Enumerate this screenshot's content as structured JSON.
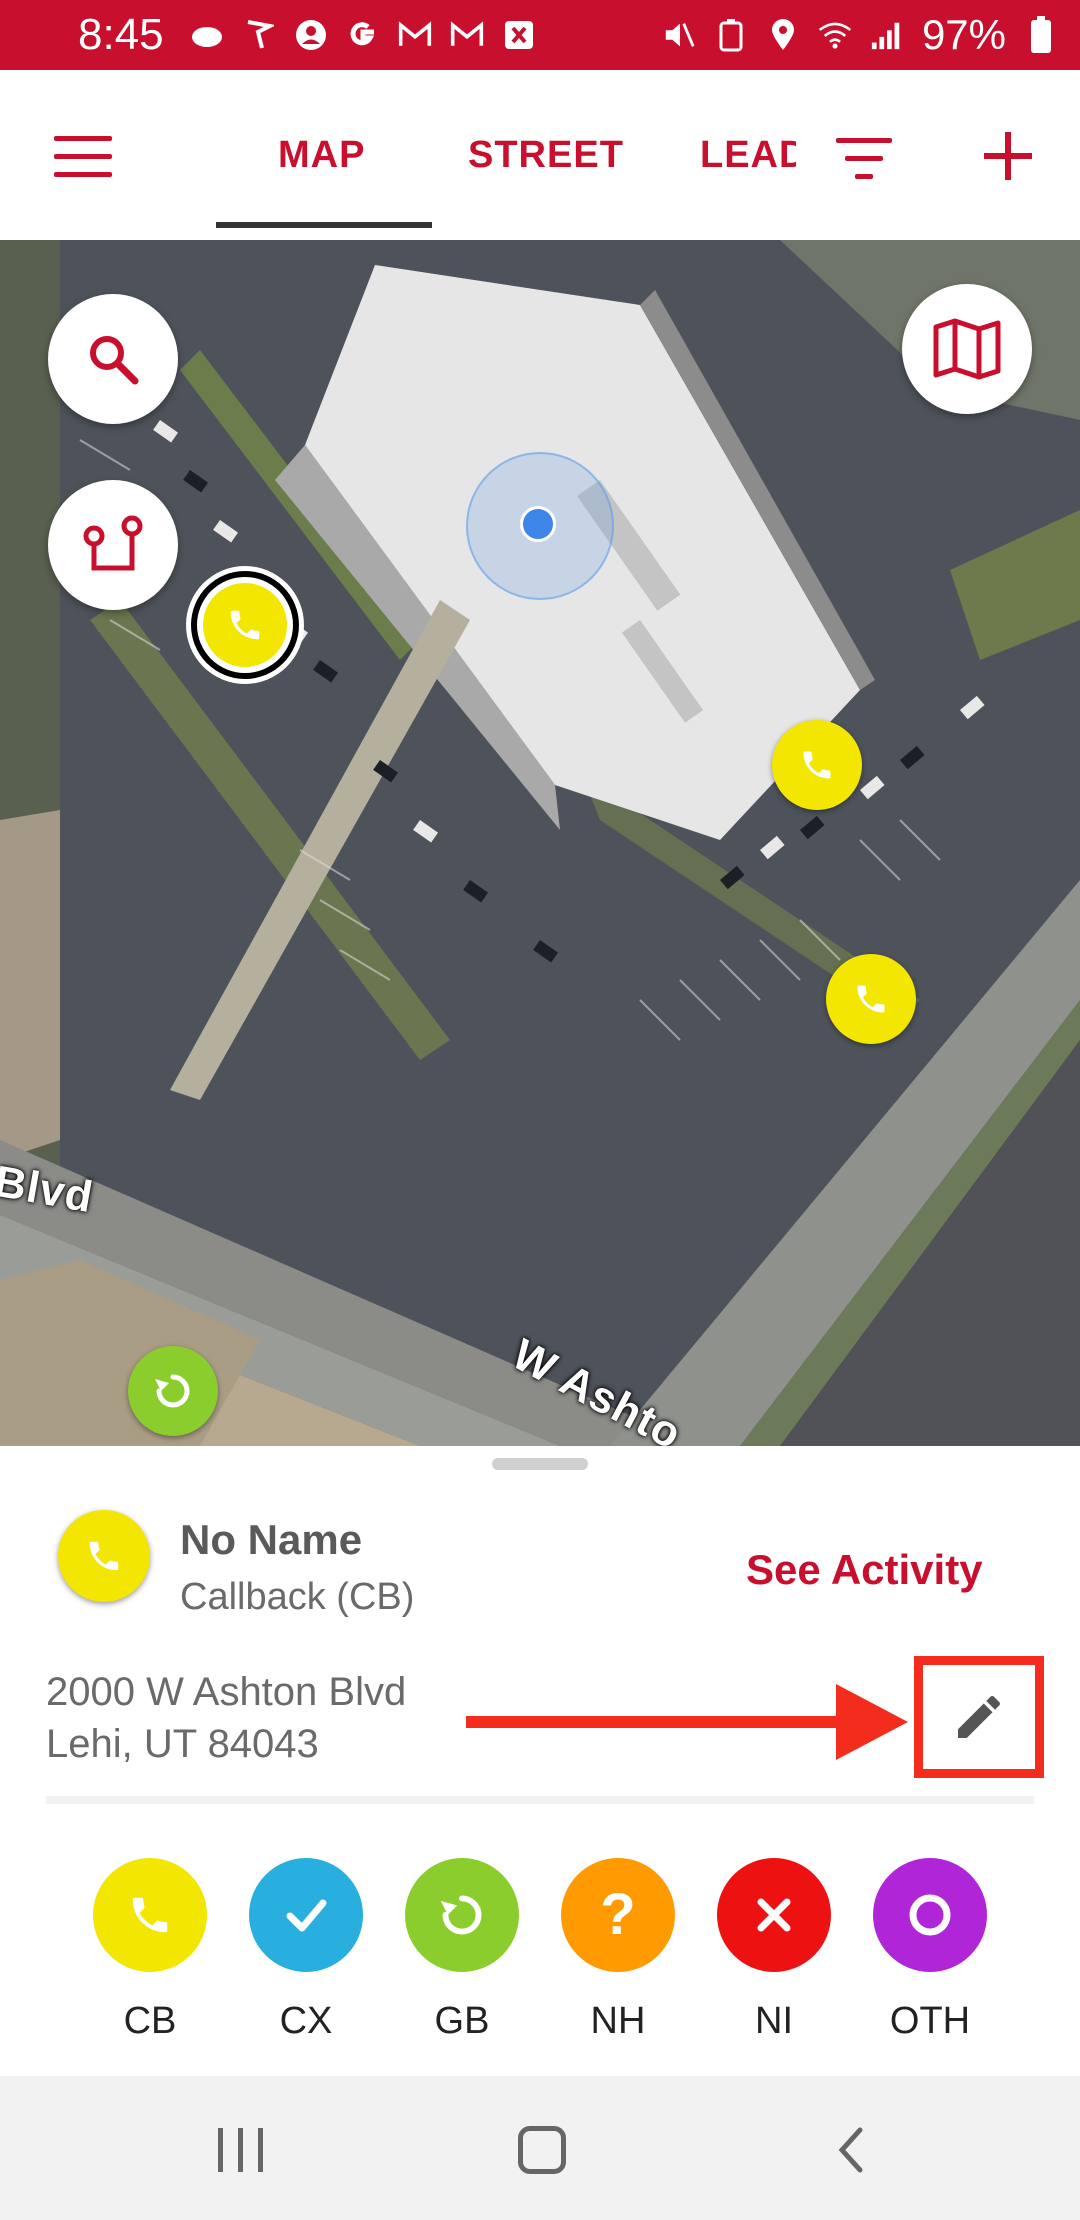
{
  "status_bar": {
    "time": "8:45",
    "battery": "97%",
    "background": "#c8102e"
  },
  "app_bar": {
    "tabs": [
      {
        "label": "MAP",
        "active": true
      },
      {
        "label": "STREET",
        "active": false
      },
      {
        "label": "LEAD",
        "active": false
      }
    ],
    "accent": "#c8102e",
    "icons": [
      "menu-icon",
      "filter-icon",
      "add-icon"
    ]
  },
  "map": {
    "labels": [
      "Blvd",
      "W Ashto"
    ],
    "buttons": [
      "search-icon",
      "route-icon",
      "map-layers-icon",
      "refresh-icon"
    ],
    "pin_color": "#f3e600"
  },
  "sheet": {
    "name": "No Name",
    "status": "Callback (CB)",
    "see_activity": "See Activity",
    "address_line1": "2000 W Ashton Blvd",
    "address_line2": "Lehi, UT 84043"
  },
  "actions": [
    {
      "code": "CB",
      "color": "#f3e600",
      "icon": "phone-icon"
    },
    {
      "code": "CX",
      "color": "#29aee0",
      "icon": "check-icon"
    },
    {
      "code": "GB",
      "color": "#8ccd2e",
      "icon": "refresh-icon"
    },
    {
      "code": "NH",
      "color": "#ff9a00",
      "icon": "question-icon"
    },
    {
      "code": "NI",
      "color": "#ee1111",
      "icon": "close-icon"
    },
    {
      "code": "OTH",
      "color": "#b125d8",
      "icon": "circle-icon"
    }
  ]
}
